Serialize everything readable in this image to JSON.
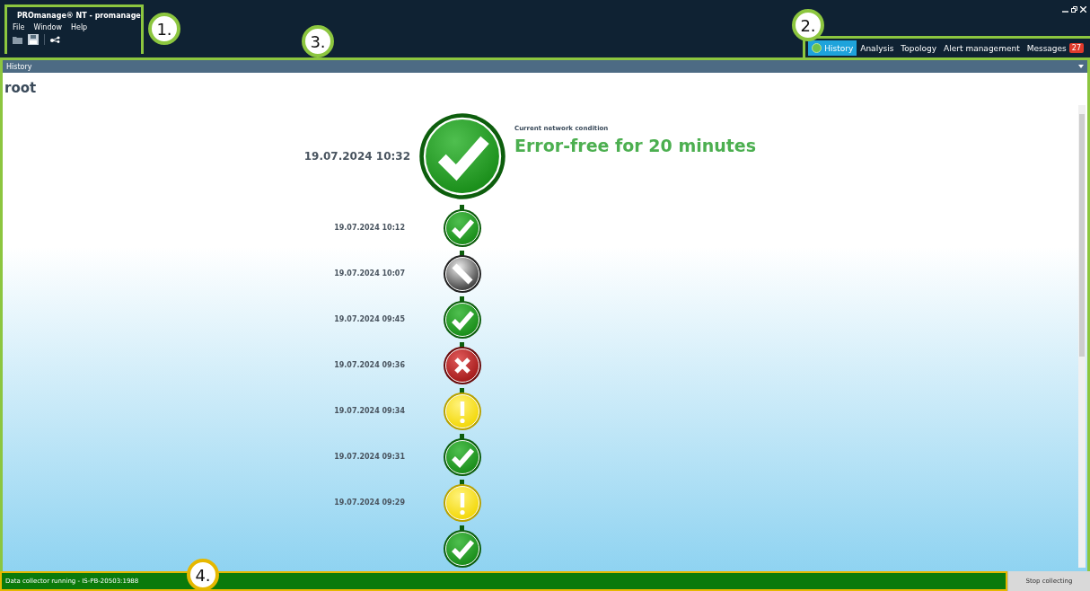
{
  "window": {
    "title": "PROmanage® NT - promanage"
  },
  "menu": [
    "File",
    "Window",
    "Help"
  ],
  "tabs": [
    {
      "label": "History",
      "selected": true,
      "icon": true
    },
    {
      "label": "Analysis",
      "selected": false
    },
    {
      "label": "Topology",
      "selected": false
    },
    {
      "label": "Alert management",
      "selected": false
    },
    {
      "label": "Messages",
      "selected": false,
      "badge": "27"
    }
  ],
  "section_title": "History",
  "node": "root",
  "current": {
    "date": "19.07.2024 10:32",
    "kind": "ok",
    "caption": "Current network condition",
    "headline": "Error-free for 20 minutes"
  },
  "history": [
    {
      "date": "19.07.2024 10:12",
      "kind": "ok"
    },
    {
      "date": "19.07.2024 10:07",
      "kind": "unknown"
    },
    {
      "date": "19.07.2024 09:45",
      "kind": "ok"
    },
    {
      "date": "19.07.2024 09:36",
      "kind": "error"
    },
    {
      "date": "19.07.2024 09:34",
      "kind": "warning"
    },
    {
      "date": "19.07.2024 09:31",
      "kind": "ok"
    },
    {
      "date": "19.07.2024 09:29",
      "kind": "warning"
    },
    {
      "kind": "ok"
    }
  ],
  "status_bar": {
    "text": "Data collector running  - IS-PB-20503:1988",
    "button": "Stop collecting"
  },
  "callouts": [
    "1.",
    "2.",
    "3.",
    "4."
  ]
}
